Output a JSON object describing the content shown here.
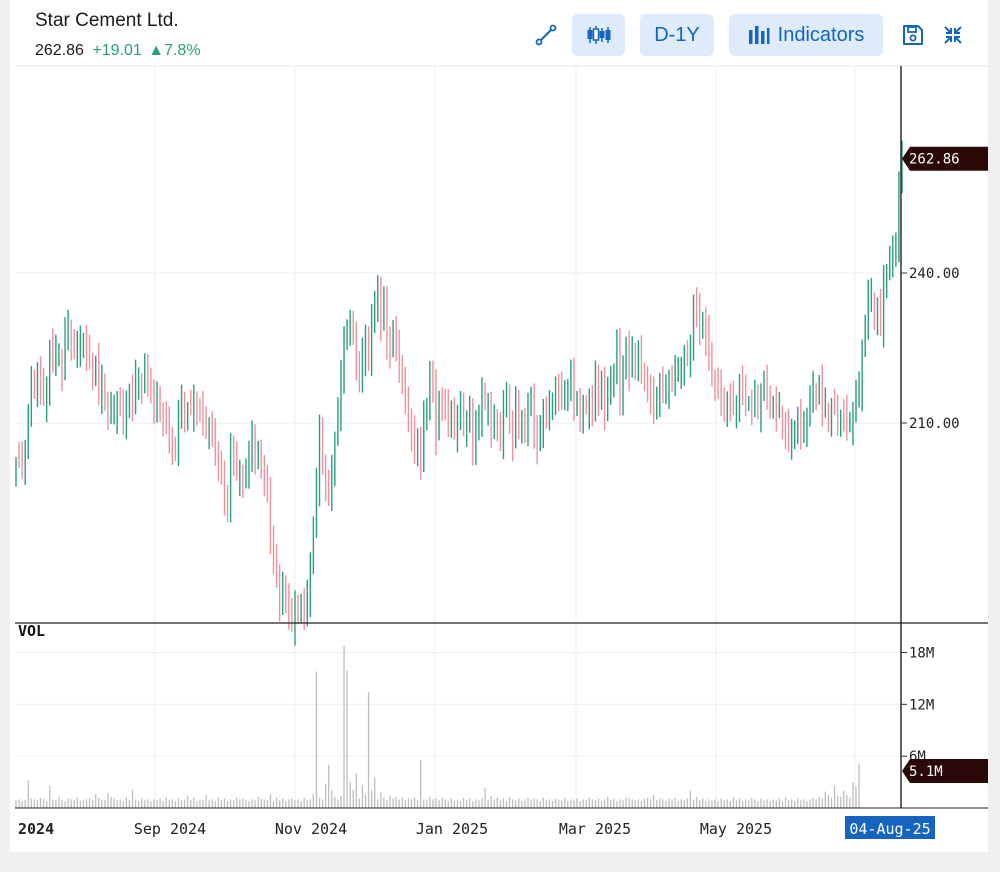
{
  "header": {
    "title": "Star Cement Ltd.",
    "price": "262.86",
    "change": "+19.01",
    "change_pct": "▲7.8%",
    "colors": {
      "up": "#26a07e",
      "accent": "#1565c0"
    }
  },
  "toolbar": {
    "draw_icon": "line-draw-icon",
    "chart_type_icon": "candlestick-icon",
    "period_label": "D-1Y",
    "indicators_label": "Indicators",
    "save_icon": "save-icon",
    "collapse_icon": "collapse-icon"
  },
  "chart_data": {
    "type": "ohlc",
    "symbol": "Star Cement Ltd.",
    "period": "D-1Y",
    "price_axis": {
      "ticks": [
        "240.00",
        "210.00"
      ],
      "range": [
        175,
        268
      ]
    },
    "volume_axis": {
      "label": "VOL",
      "ticks": [
        "18M",
        "12M",
        "6M"
      ],
      "range": [
        0,
        21
      ]
    },
    "x_ticks": [
      "2024",
      "Sep 2024",
      "Nov 2024",
      "Jan 2025",
      "Mar 2025",
      "May 2025"
    ],
    "last_price_label": "262.86",
    "last_volume_label": "5.1M",
    "crosshair_date": "04-Aug-25",
    "colors": {
      "up": "#26a07e",
      "down": "#f0929e",
      "volume": "#bdbdbd",
      "label_bg": "#2a0808",
      "date_bg": "#1565c0"
    },
    "close": [
      202,
      203,
      202,
      204,
      212,
      218,
      217,
      220,
      217,
      215,
      216,
      225,
      223,
      224,
      223,
      220,
      228,
      229,
      226,
      224,
      225,
      226,
      226,
      224,
      222,
      220,
      222,
      216,
      218,
      214,
      212,
      213,
      212,
      214,
      213,
      211,
      213,
      216,
      214,
      219,
      218,
      217,
      221,
      219,
      216,
      213,
      215,
      212,
      211,
      210,
      207,
      205,
      204,
      212,
      214,
      211,
      213,
      213,
      214,
      212,
      213,
      211,
      208,
      209,
      208,
      204,
      202,
      199,
      195,
      193,
      205,
      203,
      200,
      199,
      198,
      201,
      203,
      207,
      203,
      204,
      201,
      199,
      196,
      187,
      183,
      179,
      174,
      177,
      175,
      172,
      170,
      173,
      172,
      174,
      172,
      175,
      181,
      190,
      198,
      208,
      201,
      198,
      196,
      200,
      206,
      213,
      219,
      226,
      229,
      230,
      227,
      222,
      219,
      224,
      226,
      222,
      232,
      233,
      236,
      230,
      235,
      226,
      224,
      229,
      226,
      220,
      219,
      215,
      210,
      208,
      204,
      207,
      202,
      211,
      213,
      220,
      217,
      207,
      215,
      214,
      213,
      210,
      213,
      208,
      210,
      214,
      210,
      209,
      212,
      205,
      210,
      210,
      216,
      214,
      213,
      208,
      211,
      210,
      206,
      213,
      216,
      210,
      206,
      214,
      210,
      210,
      208,
      213,
      216,
      208,
      205,
      209,
      213,
      211,
      213,
      214,
      217,
      216,
      215,
      217,
      216,
      219,
      214,
      215,
      211,
      212,
      213,
      215,
      212,
      219,
      215,
      218,
      212,
      216,
      220,
      219,
      225,
      215,
      222,
      224,
      220,
      225,
      222,
      223,
      220,
      220,
      216,
      215,
      213,
      216,
      217,
      216,
      217,
      219,
      218,
      220,
      221,
      221,
      222,
      223,
      226,
      233,
      232,
      229,
      231,
      227,
      223,
      220,
      218,
      216,
      215,
      213,
      214,
      214,
      213,
      214,
      217,
      216,
      215,
      214,
      213,
      215,
      213,
      216,
      217,
      216,
      214,
      213,
      212,
      213,
      210,
      208,
      206,
      208,
      209,
      210,
      208,
      210,
      211,
      214,
      217,
      216,
      217,
      213,
      214,
      211,
      212,
      213,
      211,
      211,
      211,
      210,
      210,
      212,
      215,
      217,
      225,
      229,
      235,
      236,
      231,
      232,
      229,
      239,
      240,
      242,
      244,
      246,
      258,
      262.86
    ],
    "volume": [
      0.9,
      1.0,
      0.8,
      0.9,
      3.2,
      1.1,
      1.0,
      0.9,
      1.2,
      1.1,
      0.8,
      2.6,
      1.0,
      0.9,
      1.3,
      0.9,
      0.8,
      1.1,
      1.0,
      0.9,
      1.2,
      0.8,
      0.9,
      1.0,
      1.1,
      0.9,
      1.6,
      1.2,
      1.0,
      0.9,
      1.7,
      1.3,
      1.1,
      0.9,
      1.0,
      0.8,
      1.2,
      0.9,
      2.1,
      1.0,
      0.8,
      1.1,
      0.9,
      1.0,
      0.8,
      1.0,
      0.9,
      1.1,
      0.8,
      1.2,
      0.9,
      1.0,
      0.8,
      1.1,
      0.9,
      1.0,
      1.4,
      0.9,
      1.2,
      0.8,
      1.0,
      0.9,
      1.5,
      0.9,
      1.0,
      0.8,
      1.2,
      0.9,
      1.1,
      0.8,
      1.0,
      0.9,
      1.2,
      1.0,
      1.1,
      0.9,
      0.8,
      1.0,
      0.9,
      1.3,
      1.1,
      1.0,
      0.9,
      1.6,
      0.8,
      1.2,
      0.9,
      1.1,
      0.8,
      1.0,
      1.1,
      0.9,
      1.0,
      0.8,
      1.2,
      0.9,
      1.0,
      1.6,
      15.8,
      1.1,
      1.0,
      2.8,
      5.0,
      2.0,
      1.3,
      1.0,
      1.4,
      18.8,
      15.9,
      3.0,
      2.1,
      4.0,
      1.1,
      2.7,
      1.6,
      13.4,
      2.1,
      3.5,
      1.0,
      1.8,
      1.2,
      0.9,
      1.4,
      1.1,
      1.3,
      1.0,
      1.2,
      0.9,
      1.1,
      1.0,
      1.2,
      0.9,
      5.6,
      1.0,
      0.9,
      1.3,
      1.0,
      1.1,
      0.9,
      1.2,
      1.0,
      0.8,
      1.1,
      0.9,
      1.0,
      0.8,
      1.2,
      0.9,
      1.1,
      0.8,
      1.0,
      0.9,
      1.1,
      2.3,
      0.9,
      1.4,
      1.0,
      1.2,
      0.9,
      1.1,
      0.8,
      1.3,
      1.0,
      0.9,
      1.1,
      0.8,
      1.0,
      1.2,
      0.9,
      1.1,
      1.0,
      0.8,
      1.2,
      0.9,
      1.0,
      0.8,
      1.1,
      1.0,
      0.9,
      1.2,
      0.8,
      1.0,
      0.9,
      1.1,
      0.8,
      1.0,
      0.9,
      1.2,
      1.0,
      0.9,
      1.1,
      0.8,
      1.0,
      1.3,
      0.9,
      1.1,
      0.8,
      1.0,
      0.9,
      1.2,
      1.1,
      1.0,
      0.9,
      1.0,
      0.8,
      1.1,
      1.2,
      1.0,
      1.5,
      0.9,
      1.1,
      1.0,
      0.8,
      1.1,
      1.0,
      1.2,
      0.8,
      1.0,
      0.9,
      1.1,
      2.0,
      1.0,
      1.3,
      0.9,
      1.1,
      0.8,
      1.0,
      0.9,
      1.0,
      0.8,
      1.1,
      0.9,
      1.0,
      0.8,
      1.2,
      0.9,
      1.1,
      0.8,
      1.0,
      0.9,
      1.2,
      1.0,
      0.8,
      1.1,
      0.9,
      1.0,
      0.8,
      1.0,
      0.9,
      1.1,
      0.8,
      1.2,
      0.9,
      1.0,
      0.8,
      1.1,
      0.9,
      1.0,
      0.8,
      1.0,
      1.2,
      1.0,
      1.3,
      1.1,
      1.9,
      1.5,
      1.2,
      2.6,
      1.4,
      1.3,
      2.0,
      1.5,
      1.2,
      3.0,
      2.5,
      5.1
    ]
  }
}
